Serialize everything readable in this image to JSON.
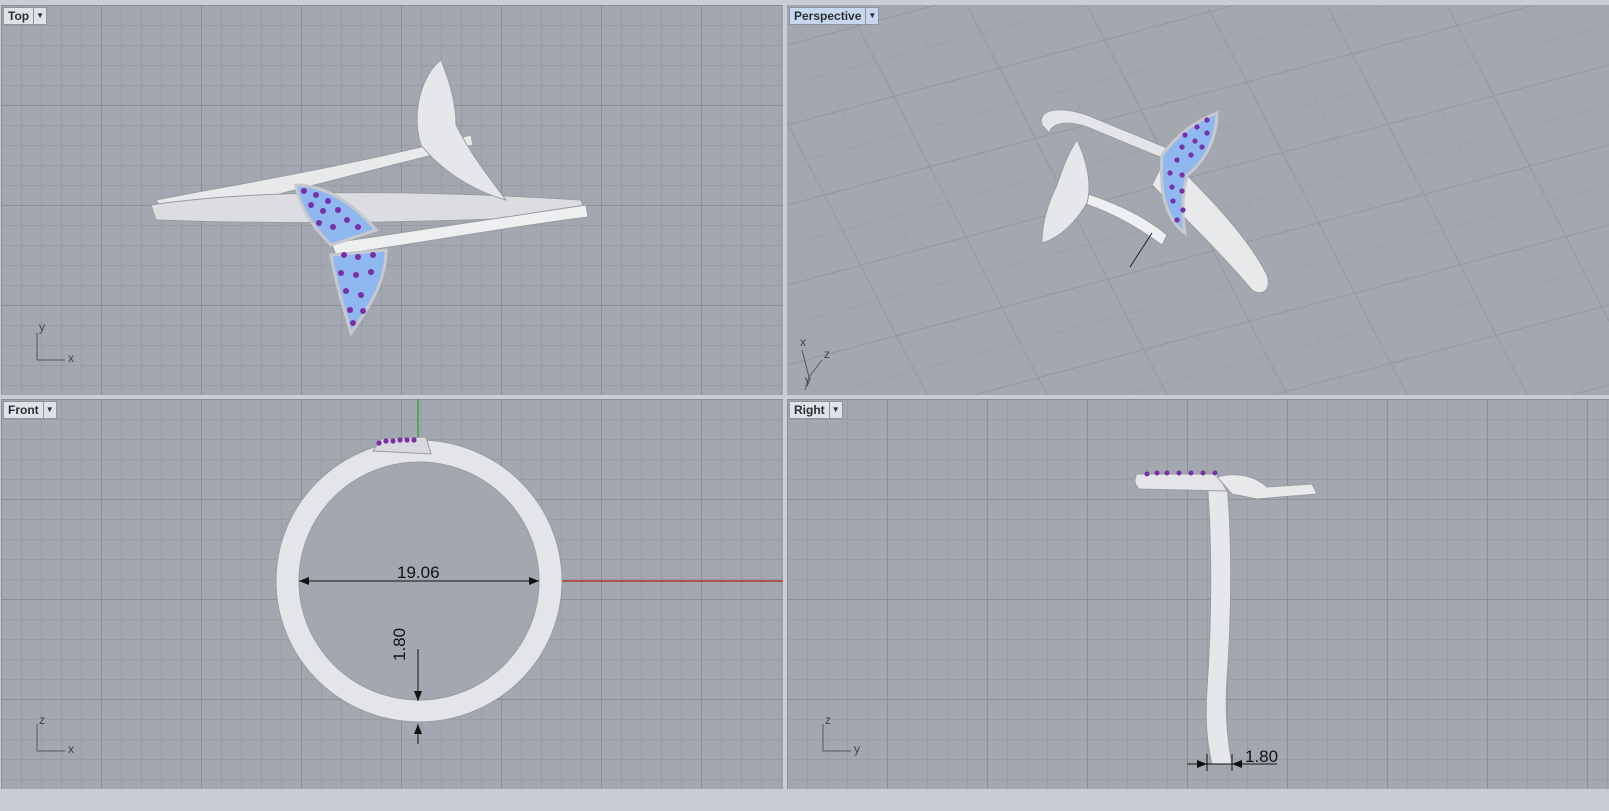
{
  "viewports": {
    "top": {
      "label": "Top",
      "axis_h": "x",
      "axis_v": "y"
    },
    "persp": {
      "label": "Perspective",
      "axis_a": "x",
      "axis_b": "z",
      "axis_c": "y"
    },
    "front": {
      "label": "Front",
      "axis_h": "x",
      "axis_v": "z"
    },
    "right": {
      "label": "Right",
      "axis_h": "y",
      "axis_v": "z"
    }
  },
  "dimensions": {
    "inner_diameter": "19.06",
    "band_thickness": "1.80",
    "band_width": "1.80"
  },
  "colors": {
    "viewport_bg": "#a3a8b0",
    "grid_major": "#8a8f97",
    "grid_minor": "#989da5",
    "metal": "#e4e5e8",
    "gem_blue": "#8fb8f0",
    "gem_purple": "#7a2fa8",
    "x_axis": "#b02020",
    "z_axis": "#20a020"
  },
  "icons": [
    "dropdown-arrow-icon",
    "axis-gizmo-icon"
  ]
}
